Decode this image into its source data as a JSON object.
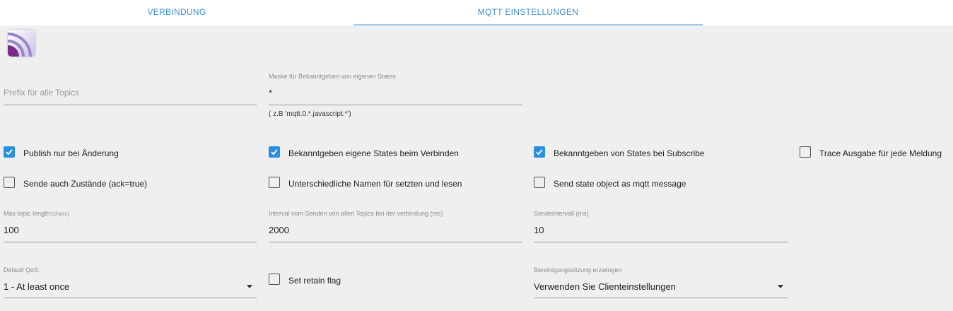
{
  "tabs": [
    {
      "label": "VERBINDUNG"
    },
    {
      "label": "MQTT EINSTELLUNGEN"
    }
  ],
  "fields": {
    "prefix": {
      "placeholder": "Prefix für alle Topics",
      "value": ""
    },
    "mask": {
      "label": "Maske für Bekanntgeben von eigenen States",
      "value": "*",
      "helper": "( z.B 'mqtt.0.*.javascript.*')"
    },
    "max_topic": {
      "label": "Max topic length:",
      "unit": "(chars)",
      "value": "100"
    },
    "interval": {
      "label": "Interval vom Senden von allen Topics bei der verbindung (ms)",
      "value": "2000"
    },
    "send_interval": {
      "label": "Sendeintervall (ms)",
      "value": "10"
    },
    "qos": {
      "label": "Default QoS:",
      "value": "1 - At least once"
    },
    "clean_session": {
      "label": "Bereinigungssitzung erzwingen",
      "value": "Verwenden Sie Clienteinstellungen"
    }
  },
  "checkboxes": {
    "publish_on_change": {
      "label": "Publish nur bei Änderung",
      "checked": true
    },
    "publish_own_states": {
      "label": "Bekanntgeben eigene States beim Verbinden",
      "checked": true
    },
    "publish_on_subscribe": {
      "label": "Bekanntgeben von States bei Subscribe",
      "checked": true
    },
    "trace": {
      "label": "Trace Ausgabe für jede Meldung",
      "checked": false
    },
    "send_ack": {
      "label": "Sende auch Zustände (ack=true)",
      "checked": false
    },
    "different_names": {
      "label": "Unterschiedliche Namen für setzten und lesen",
      "checked": false
    },
    "state_object": {
      "label": "Send state object as mqtt message",
      "checked": false
    },
    "retain": {
      "label": "Set retain flag",
      "checked": false
    }
  },
  "colors": {
    "accent": "#2b8fe0",
    "tab_text": "#3d8fd6",
    "background": "#efefef"
  }
}
